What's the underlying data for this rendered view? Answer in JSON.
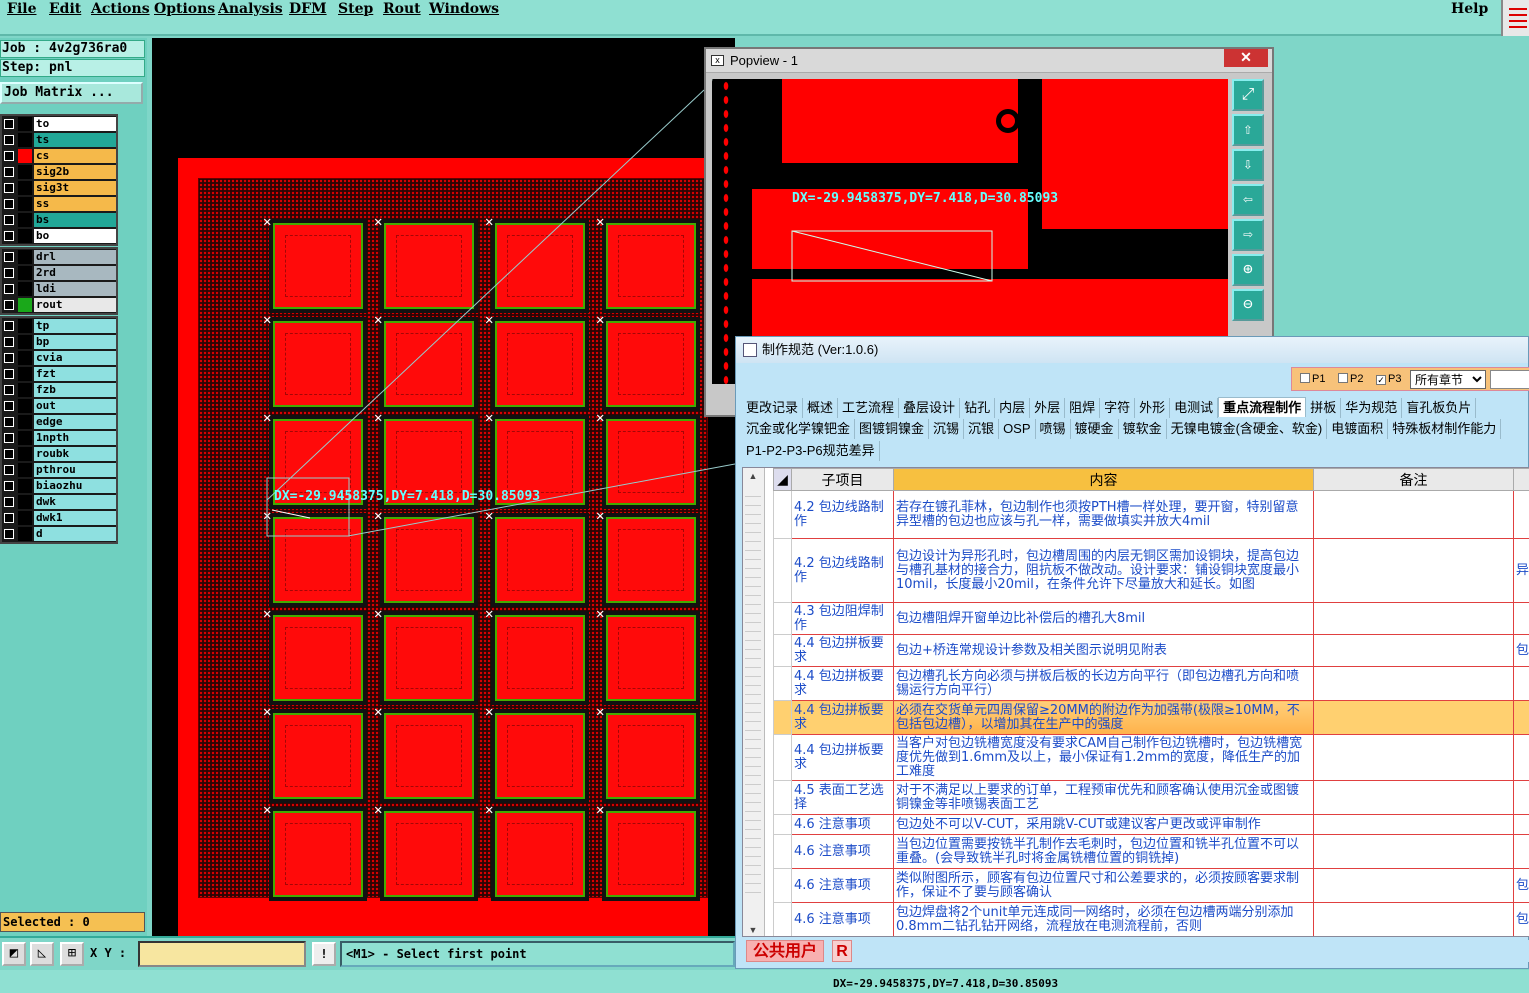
{
  "menu": {
    "items": [
      "File",
      "Edit",
      "Actions",
      "Options",
      "Analysis",
      "DFM",
      "Step",
      "Rout",
      "Windows"
    ],
    "help": "Help"
  },
  "left_panel": {
    "job": "Job : 4v2g736ra0",
    "step": "Step: pnl",
    "job_matrix": "Job Matrix ...",
    "layers_group1": [
      {
        "name": "to",
        "color": "#ffffff",
        "swatch": "#000000"
      },
      {
        "name": "ts",
        "color": "#22a898",
        "swatch": "#000000"
      },
      {
        "name": "cs",
        "color": "#f5b94a",
        "swatch": "#ff0000"
      },
      {
        "name": "sig2b",
        "color": "#f5b94a",
        "swatch": "#000000"
      },
      {
        "name": "sig3t",
        "color": "#f5b94a",
        "swatch": "#000000"
      },
      {
        "name": "ss",
        "color": "#f5b94a",
        "swatch": "#000000"
      },
      {
        "name": "bs",
        "color": "#22a898",
        "swatch": "#000000"
      },
      {
        "name": "bo",
        "color": "#ffffff",
        "swatch": "#000000"
      }
    ],
    "layers_group2": [
      {
        "name": "drl",
        "color": "#a8b8c0",
        "swatch": "#000000"
      },
      {
        "name": "2rd",
        "color": "#a8b8c0",
        "swatch": "#000000"
      },
      {
        "name": "ldi",
        "color": "#a8b8c0",
        "swatch": "#000000"
      },
      {
        "name": "rout",
        "color": "#e8e8e8",
        "swatch": "#1aa81a"
      }
    ],
    "layers_group3": [
      {
        "name": "tp",
        "color": "#8ee0e0",
        "swatch": "#000000"
      },
      {
        "name": "bp",
        "color": "#8ee0e0",
        "swatch": "#000000"
      },
      {
        "name": "cvia",
        "color": "#8ee0e0",
        "swatch": "#000000"
      },
      {
        "name": "fzt",
        "color": "#8ee0e0",
        "swatch": "#000000"
      },
      {
        "name": "fzb",
        "color": "#8ee0e0",
        "swatch": "#000000"
      },
      {
        "name": "out",
        "color": "#8ee0e0",
        "swatch": "#000000"
      },
      {
        "name": "edge",
        "color": "#8ee0e0",
        "swatch": "#000000"
      },
      {
        "name": "1npth",
        "color": "#8ee0e0",
        "swatch": "#000000"
      },
      {
        "name": "roubk",
        "color": "#8ee0e0",
        "swatch": "#000000"
      },
      {
        "name": "pthrou",
        "color": "#8ee0e0",
        "swatch": "#000000"
      },
      {
        "name": "biaozhu",
        "color": "#8ee0e0",
        "swatch": "#000000"
      },
      {
        "name": "dwk",
        "color": "#8ee0e0",
        "swatch": "#000000"
      },
      {
        "name": "dwk1",
        "color": "#8ee0e0",
        "swatch": "#000000"
      },
      {
        "name": "d",
        "color": "#8ee0e0",
        "swatch": "#000000"
      }
    ],
    "selected": "Selected : 0"
  },
  "canvas": {
    "measure_text": "DX=-29.9458375,DY=7.418,D=30.85093",
    "unit_rows": 7,
    "unit_cols": 4
  },
  "popview": {
    "title": "Popview - 1",
    "close": "✕",
    "measure_text": "DX=-29.9458375,DY=7.418,D=30.85093",
    "tools": [
      "zoom-fit-icon",
      "pan-up-icon",
      "pan-down-icon",
      "pan-left-icon",
      "pan-right-icon",
      "zoom-in-icon",
      "zoom-out-icon"
    ]
  },
  "spec": {
    "title": "制作规范 (Ver:1.0.6)",
    "filters": {
      "p1": "P1",
      "p2": "P2",
      "p3": "P3",
      "chapter": "所有章节"
    },
    "tabs_row1": [
      "更改记录",
      "概述",
      "工艺流程",
      "叠层设计",
      "钻孔",
      "内层",
      "外层",
      "阻焊",
      "字符",
      "外形",
      "电测试",
      "重点流程制作",
      "拼板",
      "华为规范",
      "盲孔板负片"
    ],
    "tabs_row2": [
      "沉金或化学镍钯金",
      "图镀铜镍金",
      "沉锡",
      "沉银",
      "OSP",
      "喷锡",
      "镀硬金",
      "镀软金",
      "无镍电镀金(含硬金、软金)",
      "电镀面积",
      "特殊板材制作能力"
    ],
    "tabs_row3": [
      "P1-P2-P3-P6规范差异"
    ],
    "active_tab": "重点流程制作",
    "columns": [
      "子项目",
      "内容",
      "备注"
    ],
    "rows": [
      {
        "sub": "4.2 包边线路制作",
        "content": "若存在镀孔菲林，包边制作也须按PTH槽一样处理，要开窗，特别留意异型槽的包边也应该与孔一样，需要做填实并放大4mil",
        "note": ""
      },
      {
        "sub": "4.2 包边线路制作",
        "content": "包边设计为异形孔时，包边槽周围的内层无铜区需加设铜块，提高包边与槽孔基材的接合力，阻抗板不做改动。设计要求：铺设铜块宽度最小10mil，长度最小20mil，在条件允许下尽量放大和延长。如图",
        "note": "异"
      },
      {
        "sub": "4.3 包边阻焊制作",
        "content": "包边槽阻焊开窗单边比补偿后的槽孔大8mil",
        "note": ""
      },
      {
        "sub": "4.4 包边拼板要求",
        "content": "包边+桥连常规设计参数及相关图示说明见附表",
        "note": "包"
      },
      {
        "sub": "4.4 包边拼板要求",
        "content": "包边槽孔长方向必须与拼板后板的长边方向平行（即包边槽孔方向和喷锡运行方向平行）",
        "note": ""
      },
      {
        "sub": "4.4 包边拼板要求",
        "content": "必须在交货单元四周保留≥20MM的附边作为加强带(极限≥10MM，不包括包边槽），以增加其在生产中的强度",
        "note": "",
        "highlight": true
      },
      {
        "sub": "4.4 包边拼板要求",
        "content": "当客户对包边铣槽宽度没有要求CAM自己制作包边铣槽时，包边铣槽宽度优先做到1.6mm及以上，最小保证有1.2mm的宽度，降低生产的加工难度",
        "note": ""
      },
      {
        "sub": "4.5 表面工艺选择",
        "content": "对于不满足以上要求的订单，工程预审优先和顾客确认使用沉金或图镀铜镍金等非喷锡表面工艺",
        "note": ""
      },
      {
        "sub": "4.6 注意事项",
        "content": "包边处不可以V-CUT，采用跳V-CUT或建议客户更改或评审制作",
        "note": ""
      },
      {
        "sub": "4.6 注意事项",
        "content": "当包边位置需要按铣半孔制作去毛刺时，包边位置和铣半孔位置不可以重叠。(会导致铣半孔时将金属铣槽位置的铜铣掉)",
        "note": ""
      },
      {
        "sub": "4.6 注意事项",
        "content": "类似附图所示，顾客有包边位置尺寸和公差要求的，必须按顾客要求制作，保证不了要与顾客确认",
        "note": "包"
      },
      {
        "sub": "4.6 注意事项",
        "content": "包边焊盘将2个unit单元连成同一网络时，必须在包边槽两端分别添加0.8mm二钻孔钻开网络，流程放在电测流程前，否则",
        "note": "包"
      }
    ],
    "user": "公共用户",
    "r_button": "R"
  },
  "bottom": {
    "xy_label": "X Y :",
    "xy_value": "",
    "bang": "!",
    "prompt": "<M1> - Select first point"
  },
  "footer": {
    "status": "DX=-29.9458375,DY=7.418,D=30.85093"
  }
}
